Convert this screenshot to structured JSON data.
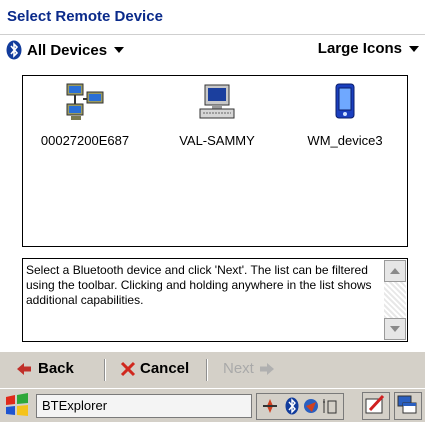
{
  "title": "Select Remote Device",
  "filter": {
    "label": "All Devices"
  },
  "view": {
    "label": "Large Icons"
  },
  "devices": [
    {
      "name": "00027200E687",
      "icon": "network-computer-icon"
    },
    {
      "name": "VAL-SAMMY",
      "icon": "desktop-computer-icon"
    },
    {
      "name": "WM_device3",
      "icon": "pda-device-icon"
    }
  ],
  "help_text": "Select a Bluetooth device and click 'Next'.  The list can be filtered using the toolbar.  Clicking and holding anywhere in the list shows additional capabilities.",
  "nav": {
    "back": "Back",
    "cancel": "Cancel",
    "next": "Next"
  },
  "taskbar": {
    "app_label": "BTExplorer"
  },
  "colors": {
    "title": "#0a2a8a",
    "bar": "#d4d0c8",
    "back_arrow": "#c0302a",
    "cancel_x": "#d0281e"
  }
}
